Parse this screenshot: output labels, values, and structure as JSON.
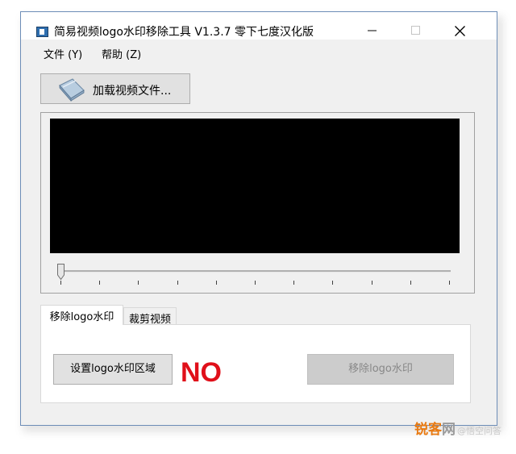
{
  "window": {
    "title": "简易视频logo水印移除工具 V1.3.7 零下七度汉化版",
    "controls": [
      "minimize-icon",
      "maximize-icon",
      "close-icon"
    ]
  },
  "menu": {
    "file": "文件 (Y)",
    "help": "帮助 (Z)"
  },
  "toolbar": {
    "load_label": "加载视频文件..."
  },
  "preview": {
    "slider_position": 0,
    "tick_count": 11
  },
  "tabs": [
    {
      "label": "移除logo水印",
      "active": true
    },
    {
      "label": "裁剪视频",
      "active": false
    }
  ],
  "panel": {
    "set_region_label": "设置logo水印区域",
    "status": "NO",
    "status_color": "#e0101a",
    "remove_label": "移除logo水印",
    "remove_enabled": false
  },
  "watermark": {
    "part1": "锐客",
    "part2": "网",
    "sub": "@悟空问答"
  }
}
